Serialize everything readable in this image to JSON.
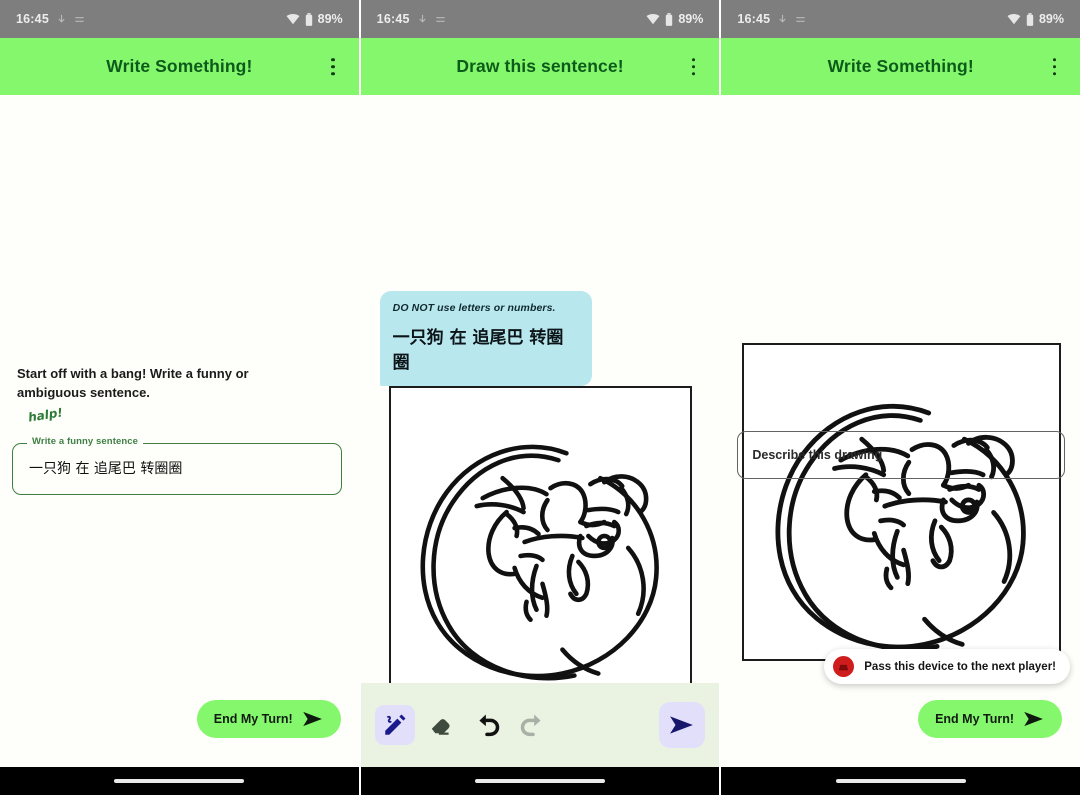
{
  "status_bar": {
    "time": "16:45",
    "battery_percent": "89%",
    "icons": [
      "notification-icon",
      "notification-icon",
      "wifi-icon",
      "battery-icon"
    ]
  },
  "theme": {
    "appbar_green": "#85f76d",
    "appbar_title_green": "#0d5b1b",
    "bubble_cyan": "#b9e7ee",
    "tool_selected_lavender": "#e2dffb",
    "toolbar_bg": "#eaf3e2",
    "field_outline_green": "#3f7f45",
    "toast_avatar_red": "#cf1c1c",
    "canvas_ink": "#111111"
  },
  "screens": [
    {
      "id": "write-something",
      "appbar": {
        "title": "Write Something!",
        "menu_icon": "kebab-menu-icon"
      },
      "prompt": "Start off with a bang! Write a funny or ambiguous sentence.",
      "hint_doodle": "halp!",
      "text_field": {
        "label": "Write a funny sentence",
        "value": "一只狗 在 追尾巴 转圈圈",
        "placeholder": "Write a funny sentence"
      },
      "end_turn_button": {
        "label": "End My Turn!",
        "icon": "send-arrow-icon"
      }
    },
    {
      "id": "draw-this-sentence",
      "appbar": {
        "title": "Draw this sentence!",
        "menu_icon": "kebab-menu-icon"
      },
      "bubble": {
        "warning": "DO NOT use letters or numbers.",
        "sentence": "一只狗 在 追尾巴 转圈圈"
      },
      "canvas": {
        "name": "drawing-canvas",
        "content": "dog chasing its tail in a circle"
      },
      "toolbar": {
        "tools": [
          {
            "name": "pen-tool",
            "icon": "pen-icon",
            "selected": true
          },
          {
            "name": "eraser-tool",
            "icon": "eraser-icon",
            "selected": false
          },
          {
            "name": "undo-button",
            "icon": "undo-icon",
            "enabled": true
          },
          {
            "name": "redo-button",
            "icon": "redo-icon",
            "enabled": false
          }
        ],
        "submit": {
          "name": "submit-drawing-button",
          "icon": "send-arrow-icon"
        }
      }
    },
    {
      "id": "describe-drawing",
      "appbar": {
        "title": "Write Something!",
        "menu_icon": "kebab-menu-icon"
      },
      "canvas": {
        "name": "drawing-preview",
        "content": "dog chasing its tail in a circle"
      },
      "describe_field": {
        "placeholder": "Describe this drawing",
        "value": ""
      },
      "toast": {
        "text": "Pass this device to the next player!",
        "avatar_icon": "player-avatar-icon"
      },
      "end_turn_button": {
        "label": "End My Turn!",
        "icon": "send-arrow-icon"
      }
    }
  ]
}
